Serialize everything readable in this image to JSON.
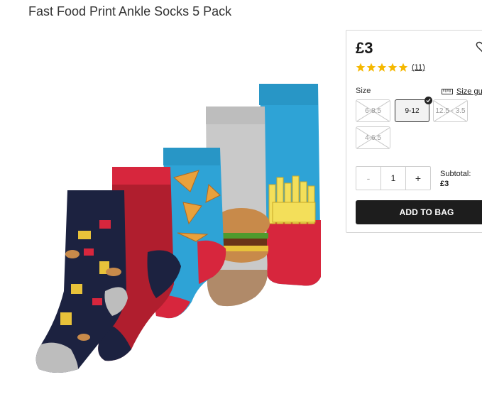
{
  "product": {
    "title": "Fast Food Print Ankle Socks 5 Pack",
    "price": "£3",
    "rating": 5,
    "review_count": "(11)"
  },
  "sizes": {
    "label": "Size",
    "guide_label": "Size gu",
    "options": [
      {
        "label": "6-8.5",
        "available": false,
        "selected": false
      },
      {
        "label": "9-12",
        "available": true,
        "selected": true
      },
      {
        "label": "12.5 - 3.5",
        "available": false,
        "selected": false
      },
      {
        "label": "4-6.5",
        "available": false,
        "selected": false
      }
    ]
  },
  "quantity": {
    "minus": "-",
    "value": "1",
    "plus": "+"
  },
  "subtotal": {
    "label": "Subtotal:",
    "value": "£3"
  },
  "actions": {
    "add_to_bag": "ADD TO BAG"
  },
  "colors": {
    "star": "#f5b800",
    "button": "#1d1d1d",
    "sock_navy": "#1c2240",
    "sock_red": "#d7263d",
    "sock_blue": "#2ea3d6",
    "sock_grey": "#c9c9c9"
  }
}
